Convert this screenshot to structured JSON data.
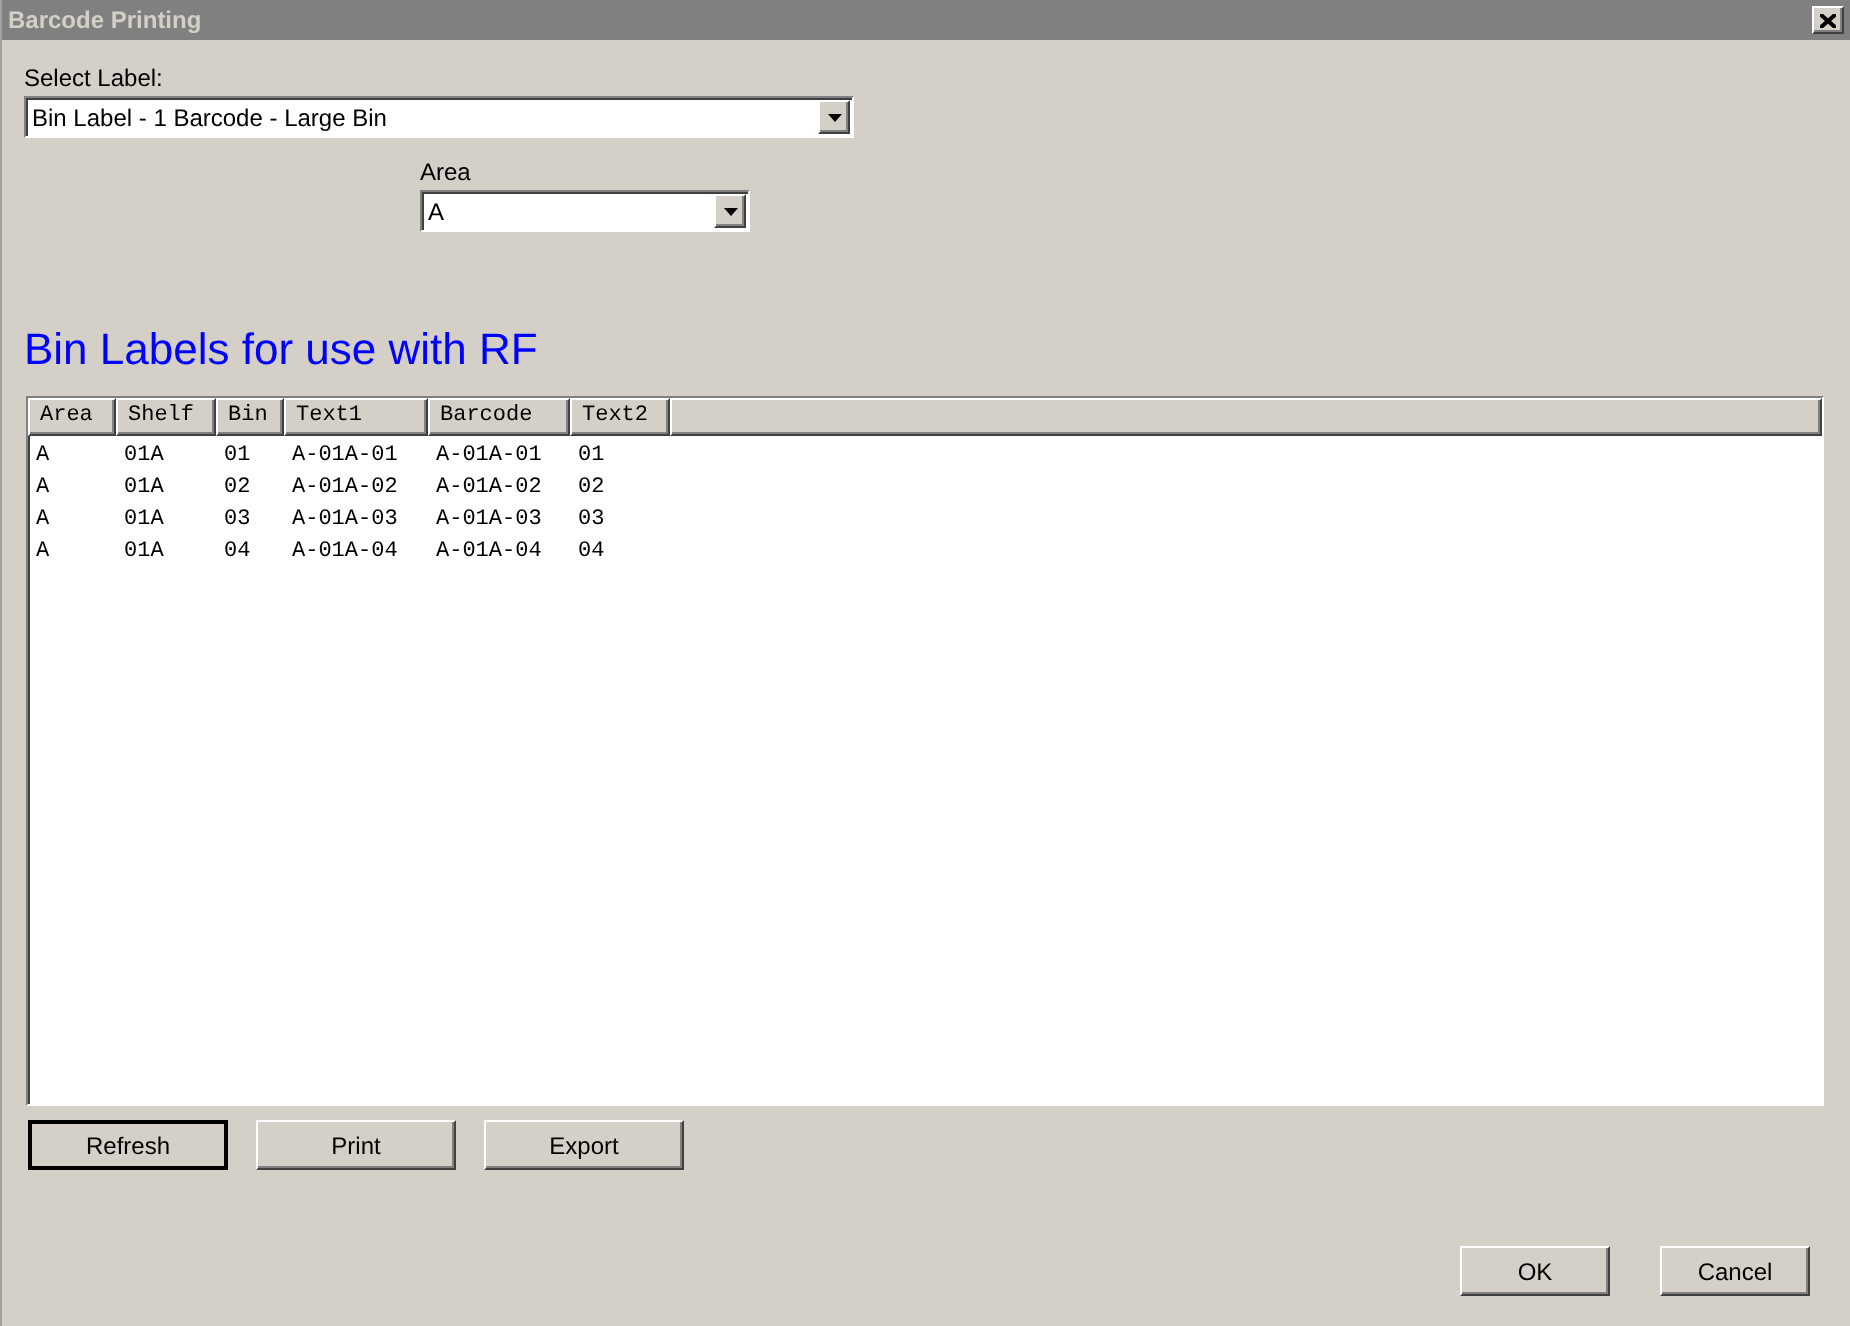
{
  "window": {
    "title": "Barcode Printing"
  },
  "select_label": {
    "label": "Select Label:",
    "value": "Bin Label - 1 Barcode - Large Bin"
  },
  "area": {
    "label": "Area",
    "value": "A"
  },
  "heading": "Bin Labels for use with RF",
  "table": {
    "columns": [
      "Area",
      "Shelf",
      "Bin",
      "Text1",
      "Barcode",
      "Text2"
    ],
    "rows": [
      [
        "A",
        "01A",
        "01",
        "A-01A-01",
        "A-01A-01",
        "01"
      ],
      [
        "A",
        "01A",
        "02",
        "A-01A-02",
        "A-01A-02",
        "02"
      ],
      [
        "A",
        "01A",
        "03",
        "A-01A-03",
        "A-01A-03",
        "03"
      ],
      [
        "A",
        "01A",
        "04",
        "A-01A-04",
        "A-01A-04",
        "04"
      ]
    ]
  },
  "actions": [
    {
      "label": "Refresh",
      "default": true
    },
    {
      "label": "Print",
      "default": false
    },
    {
      "label": "Export",
      "default": false
    }
  ],
  "dialog_buttons": [
    {
      "label": "OK",
      "default": false
    },
    {
      "label": "Cancel",
      "default": false
    }
  ]
}
